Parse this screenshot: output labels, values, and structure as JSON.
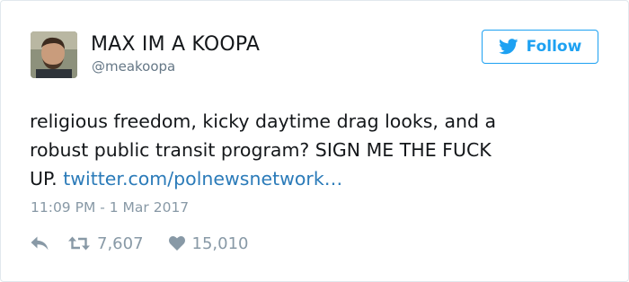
{
  "colors": {
    "accent": "#1da1f2",
    "link": "#2b7bb9",
    "muted": "#8899a6",
    "text": "#14171a"
  },
  "user": {
    "display_name": "MAX IM A KOOPA",
    "screen_name": "@meakoopa",
    "avatar_icon": "profile-photo"
  },
  "follow": {
    "label": "Follow",
    "icon": "twitter-bird-icon"
  },
  "tweet": {
    "text_line1": "religious freedom, kicky daytime drag looks, and a",
    "text_line2": "robust public transit program? SIGN ME THE FUCK",
    "text_line3": "UP. ",
    "link": "twitter.com/polnewsnetwork…",
    "timestamp": "11:09 PM - 1 Mar 2017"
  },
  "actions": {
    "reply_icon": "reply-arrow-icon",
    "retweet_icon": "retweet-icon",
    "retweet_count": "7,607",
    "like_icon": "heart-icon",
    "like_count": "15,010"
  }
}
